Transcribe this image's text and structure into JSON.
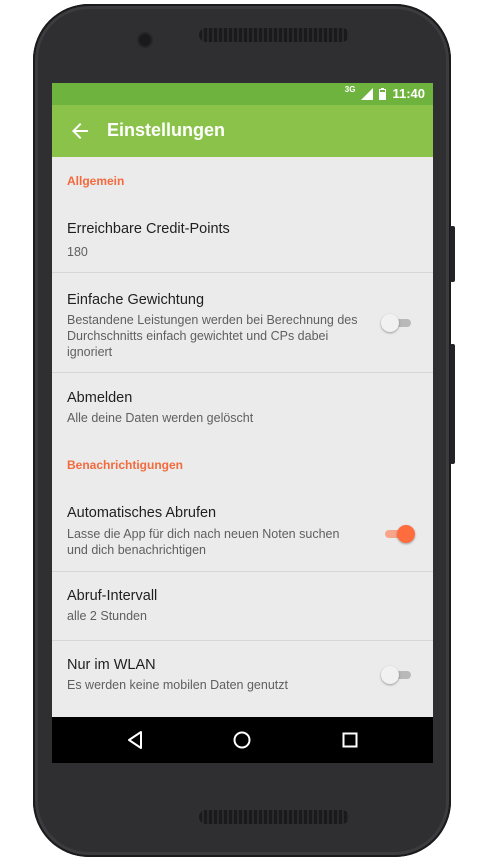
{
  "status_bar": {
    "network": "3G",
    "time": "11:40"
  },
  "app_bar": {
    "title": "Einstellungen",
    "back_icon": "arrow-back-icon"
  },
  "sections": [
    {
      "title": "Allgemein"
    },
    {
      "title": "Benachrichtigungen"
    }
  ],
  "items": [
    {
      "title": "Erreichbare Credit-Points",
      "summary": "180"
    },
    {
      "title": "Einfache Gewichtung",
      "summary_lines": [
        "Bestandene Leistungen werden bei Berechnung des",
        "Durchschnitts einfach gewichtet und CPs dabei",
        "ignoriert"
      ],
      "switch_on": false
    },
    {
      "title": "Abmelden",
      "summary": "Alle deine Daten werden gelöscht"
    },
    {
      "title": "Automatisches Abrufen",
      "summary_lines": [
        "Lasse die App für dich nach neuen Noten suchen",
        "und dich benachrichtigen"
      ],
      "switch_on": true
    },
    {
      "title": "Abruf-Intervall",
      "summary": "alle 2 Stunden"
    },
    {
      "title": "Nur im WLAN",
      "summary": "Es werden keine mobilen Daten genutzt",
      "switch_on": false
    }
  ],
  "nav_bar": {
    "back": "triangle-back-icon",
    "home": "circle-home-icon",
    "recents": "square-recents-icon"
  },
  "colors": {
    "status_bar": "#6fb33f",
    "app_bar": "#8bc34a",
    "accent": "#f26a3d",
    "background": "#ebebeb"
  }
}
